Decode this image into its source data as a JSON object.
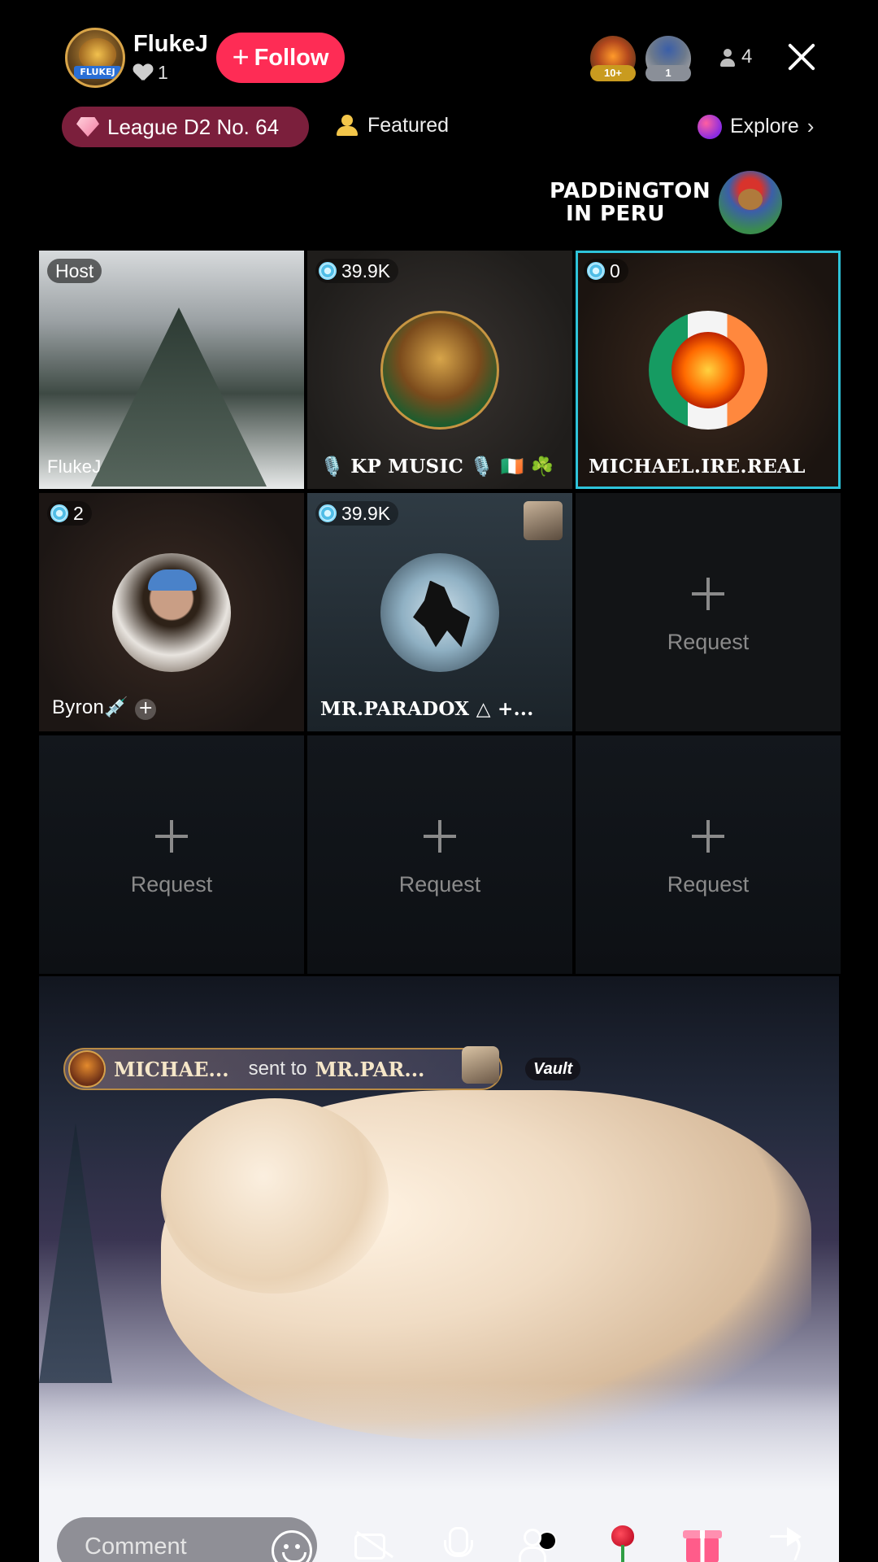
{
  "header": {
    "host_name": "FlukeJ",
    "host_avatar_tag": "FLUKEJ",
    "likes": "1",
    "follow_label": "Follow",
    "viewers": [
      {
        "badge": "10+",
        "icon": "viewer-avatar"
      },
      {
        "badge": "1",
        "icon": "viewer-avatar"
      }
    ],
    "viewer_count": "4",
    "league_label": "League D2 No. 64",
    "featured_label": "Featured",
    "explore_label": "Explore",
    "promo_line1": "PADDiNGTON",
    "promo_line2": "IN PERU"
  },
  "grid": {
    "tiles": [
      {
        "type": "host",
        "tag": "Host",
        "name": "FlukeJ"
      },
      {
        "type": "guest",
        "score": "39.9K",
        "name": "🎙️ KP MUSIC 🎙️ 🇮🇪 ☘️"
      },
      {
        "type": "guest",
        "score": "0",
        "name": "MICHAEL.IRE.REAL",
        "highlighted": true
      },
      {
        "type": "guest",
        "score": "2",
        "name": "Byron💉"
      },
      {
        "type": "guest",
        "score": "39.9K",
        "name": "MR.PARADOX △ +..."
      },
      {
        "type": "request",
        "label": "Request"
      },
      {
        "type": "request",
        "label": "Request"
      },
      {
        "type": "request",
        "label": "Request"
      },
      {
        "type": "request",
        "label": "Request"
      }
    ]
  },
  "gift_banner": {
    "from": "MICHAE...",
    "sent_to": "sent to",
    "to": "MR.PAR...",
    "badge": "Vault"
  },
  "bottom_bar": {
    "comment_placeholder": "Comment",
    "icons": [
      "emoji-icon",
      "camera-off-icon",
      "mic-icon",
      "guests-icon",
      "rose-gift-icon",
      "gift-icon",
      "share-icon"
    ]
  },
  "colors": {
    "follow": "#fe2c55",
    "league_pill": "#7b1f3c",
    "highlight_border": "#2ec3d9",
    "request_text": "#8a8a8a"
  }
}
